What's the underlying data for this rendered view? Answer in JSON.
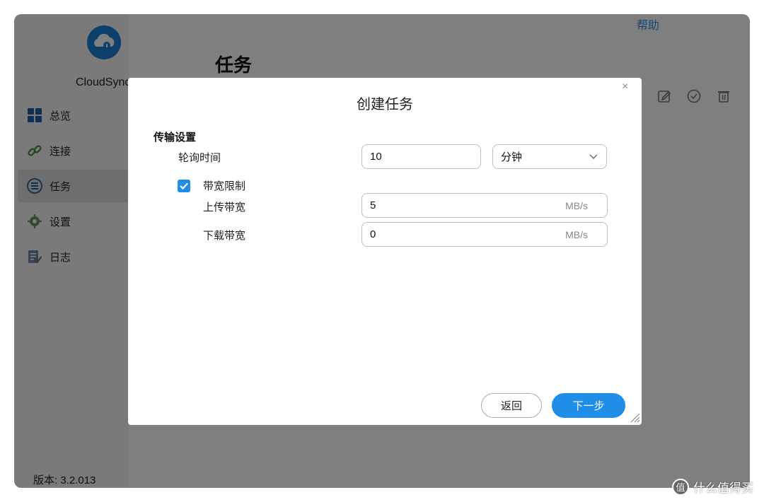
{
  "app": {
    "name": "CloudSync",
    "version": "版本: 3.2.013",
    "help": "帮助",
    "page_title": "任务"
  },
  "sidebar": {
    "items": [
      {
        "label": "总览",
        "icon": "overview-grid-icon"
      },
      {
        "label": "连接",
        "icon": "link-icon"
      },
      {
        "label": "任务",
        "icon": "task-list-icon",
        "active": true
      },
      {
        "label": "设置",
        "icon": "gear-icon"
      },
      {
        "label": "日志",
        "icon": "log-icon"
      }
    ]
  },
  "toolbar": {
    "icons": [
      "edit-icon",
      "check-circle-icon",
      "trash-icon"
    ]
  },
  "dialog": {
    "title": "创建任务",
    "close": "×",
    "section_title": "传输设置",
    "poll_label": "轮询时间",
    "poll_value": "10",
    "poll_unit_selected": "分钟",
    "bandwidth_checkbox_label": "带宽限制",
    "bandwidth_checked": true,
    "upload_label": "上传带宽",
    "upload_value": "5",
    "upload_unit": "MB/s",
    "download_label": "下载带宽",
    "download_value": "0",
    "download_unit": "MB/s",
    "back_button": "返回",
    "next_button": "下一步"
  },
  "watermark": {
    "badge": "值",
    "text": "什么值得买"
  },
  "colors": {
    "accent": "#1e8ee9",
    "overlay": "rgba(0,0,0,0.5)",
    "sidebar_bg": "#f5f5f7"
  }
}
